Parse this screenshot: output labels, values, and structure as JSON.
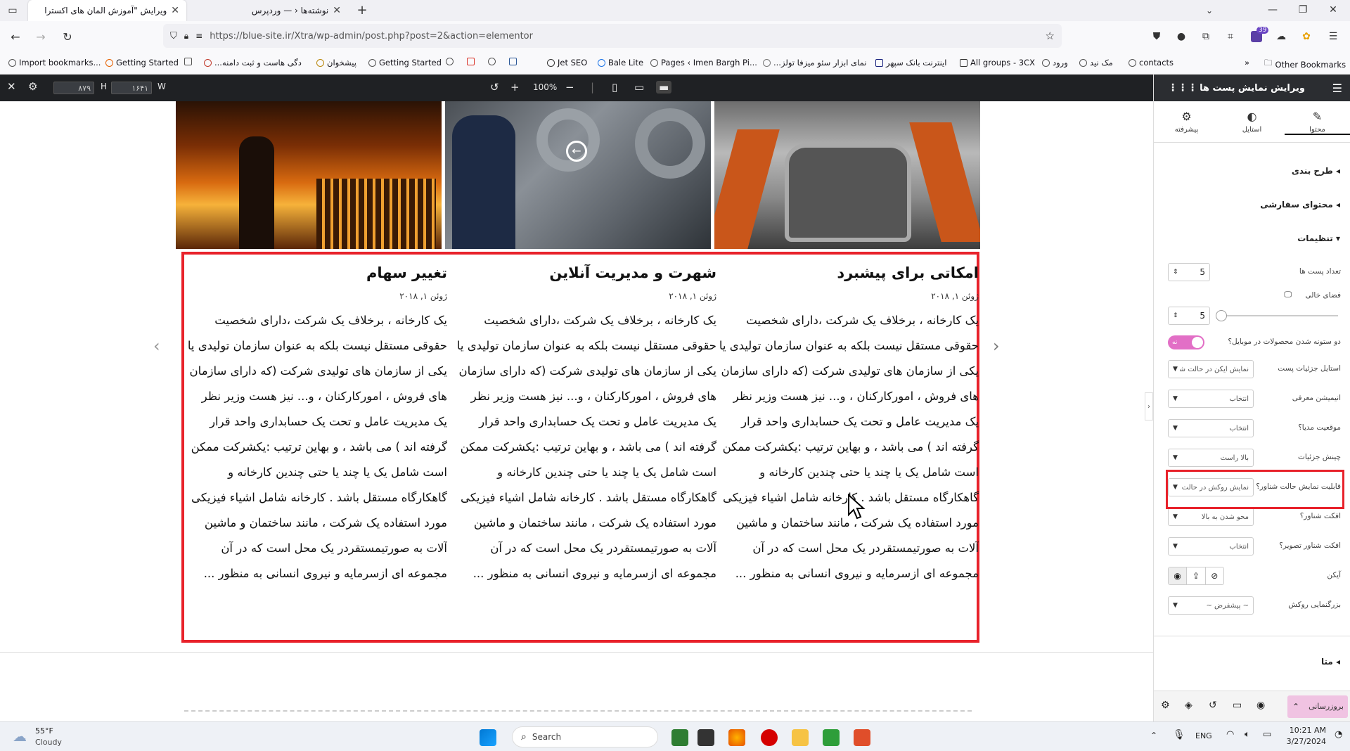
{
  "browser": {
    "tabs": [
      {
        "title": "ویرایش \"آموزش المان های اکسترا ..."
      },
      {
        "title": "نوشته‌ها ‹ — وردپرس"
      }
    ],
    "url": "https://blue-site.ir/Xtra/wp-admin/post.php?post=2&action=elementor",
    "badge_count": "39",
    "bookmarks": [
      "Import bookmarks...",
      "Getting Started",
      "...دگی هاست و ثبت دامنه",
      "پیشخوان",
      "Getting Started",
      "Jet SEO",
      "Bale Lite",
      "Pages ‹ Imen Bargh Pi...",
      "...نمای ابزار سئو میزفا تولز",
      "اینترنت بانک سپهر",
      "All groups - 3CX",
      "ورود",
      "مک نید",
      "contacts",
      "Other Bookmarks"
    ]
  },
  "editor_top": {
    "width_value": "۸۷۹",
    "height_label": "H",
    "height_value": "۱۶۴۱",
    "width_label": "W",
    "zoom": "100%"
  },
  "posts": [
    {
      "title": "تغییر سهام",
      "date": "ژوئن ۱, ۲۰۱۸",
      "excerpt": "یک کارخانه ، برخلاف یک شرکت ،دارای شخصیت حقوقی مستقل نیست بلکه به عنوان سازمان تولیدی یا یکی از سازمان های تولیدی شرکت (که دارای سازمان های فروش ، امورکارکنان ، و... نیز هست وزیر نظر یک مدیریت عامل و تحت یک حسابداری واحد قرار گرفته اند ) می باشد ، و بهاین ترتیب :یکشرکت ممکن است شامل یک یا چند یا حتی چندین کارخانه و گاهکارگاه مستقل باشد . کارخانه شامل اشیاء فیزیکی مورد استفاده یک شرکت ، مانند ساختمان و ماشین آلات به صورتیمستقردر یک محل است که در آن مجموعه ای ازسرمایه و نیروی انسانی به منظور ..."
    },
    {
      "title": "شهرت و مدیریت آنلاین",
      "date": "ژوئن ۱, ۲۰۱۸",
      "excerpt": "یک کارخانه ، برخلاف یک شرکت ،دارای شخصیت حقوقی مستقل نیست بلکه به عنوان سازمان تولیدی یا یکی از سازمان های تولیدی شرکت (که دارای سازمان های فروش ، امورکارکنان ، و... نیز هست وزیر نظر یک مدیریت عامل و تحت یک حسابداری واحد قرار گرفته اند ) می باشد ، و بهاین ترتیب :یکشرکت ممکن است شامل یک یا چند یا حتی چندین کارخانه و گاهکارگاه مستقل باشد . کارخانه شامل اشیاء فیزیکی مورد استفاده یک شرکت ، مانند ساختمان و ماشین آلات به صورتیمستقردر یک محل است که در آن مجموعه ای ازسرمایه و نیروی انسانی به منظور ..."
    },
    {
      "title": "امکاتی برای پیشبرد",
      "date": "ژوئن ۱, ۲۰۱۸",
      "excerpt": "یک کارخانه ، برخلاف یک شرکت ،دارای شخصیت حقوقی مستقل نیست بلکه به عنوان سازمان تولیدی یا یکی از سازمان های تولیدی شرکت (که دارای سازمان های فروش ، امورکارکنان ، و... نیز هست وزیر نظر یک مدیریت عامل و تحت یک حسابداری واحد قرار گرفته اند ) می باشد ، و بهاین ترتیب :یکشرکت ممکن است شامل یک یا چند یا حتی چندین کارخانه و گاهکارگاه مستقل باشد . کارخانه شامل اشیاء فیزیکی مورد استفاده یک شرکت ، مانند ساختمان و ماشین آلات به صورتیمستقردر یک محل است که در آن مجموعه ای ازسرمایه و نیروی انسانی به منظور ..."
    }
  ],
  "panel": {
    "title": "ویرایش نمایش پست ها",
    "tabs": [
      "محتوا",
      "استایل",
      "پیشرفته"
    ],
    "sections": {
      "layout": "طرح بندی",
      "custom": "محتوای سفارشی",
      "settings": "تنظیمات",
      "meta": "متا"
    },
    "fields": {
      "post_count": {
        "label": "تعداد پست ها",
        "value": "5"
      },
      "spacing": {
        "label": "فضای خالی",
        "value": "5"
      },
      "mobile_columns": {
        "label": "دو ستونه شدن محصولات در موبایل؟",
        "value": "نه"
      },
      "detail_style": {
        "label": "استایل جزئیات پست",
        "value": "نمایش آیکن در حالت شناو"
      },
      "intro_anim": {
        "label": "انیمیشن معرفی",
        "value": "انتخاب"
      },
      "media_position": {
        "label": "موقعیت مدیا؟",
        "value": "انتخاب"
      },
      "detail_layout": {
        "label": "چینش جزئیات",
        "value": "بالا راست"
      },
      "hover_mode": {
        "label": "قابلیت نمایش حالت شناور؟",
        "value": "نمایش روکش در حالت ش"
      },
      "hover_effect": {
        "label": "افکت شناور؟",
        "value": "محو شدن به بالا"
      },
      "image_hover": {
        "label": "افکت شناور تصویر؟",
        "value": "انتخاب"
      },
      "icon": {
        "label": "آیکن"
      },
      "overlay_size": {
        "label": "بزرگنمایی روکش",
        "value": "~ پیشفرض ~"
      }
    },
    "update_button": "بروزرسانی"
  },
  "taskbar": {
    "temp": "55°F",
    "weather": "Cloudy",
    "search": "Search",
    "lang": "ENG",
    "time": "10:21 AM",
    "date": "3/27/2024"
  },
  "colors": {
    "highlight": "#e8222b",
    "accent": "#e26fc6"
  }
}
